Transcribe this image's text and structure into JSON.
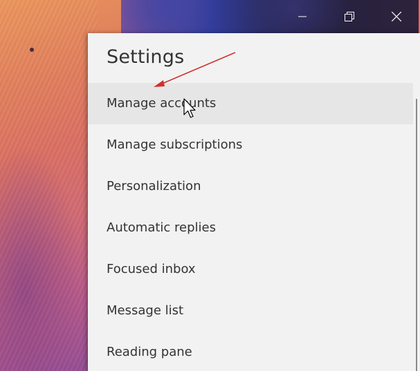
{
  "window": {
    "controls": [
      {
        "name": "minimize-icon"
      },
      {
        "name": "restore-icon"
      },
      {
        "name": "close-icon"
      }
    ]
  },
  "settings": {
    "title": "Settings",
    "items": [
      {
        "label": "Manage accounts",
        "hovered": true
      },
      {
        "label": "Manage subscriptions"
      },
      {
        "label": "Personalization"
      },
      {
        "label": "Automatic replies"
      },
      {
        "label": "Focused inbox"
      },
      {
        "label": "Message list"
      },
      {
        "label": "Reading pane"
      }
    ]
  },
  "colors": {
    "panel_bg": "#f2f2f2",
    "hover_bg": "#e6e6e6",
    "text": "#333333",
    "annotation_arrow": "#d32f2f"
  }
}
